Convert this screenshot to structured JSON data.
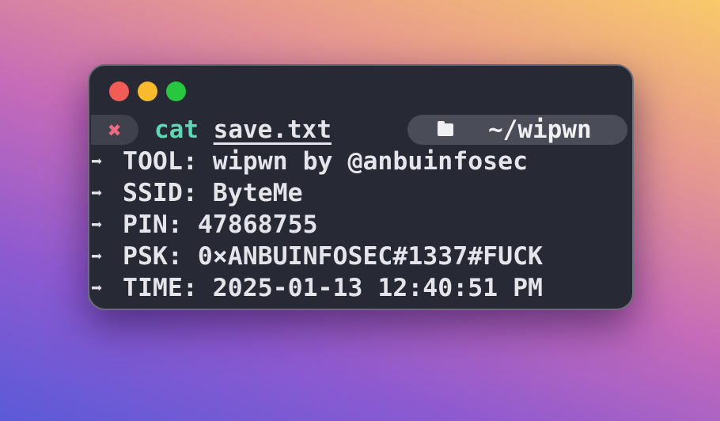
{
  "window": {
    "controls": [
      {
        "name": "close",
        "color": "#f25c57"
      },
      {
        "name": "minimize",
        "color": "#f9bb2c"
      },
      {
        "name": "maximize",
        "color": "#27c840"
      }
    ]
  },
  "prompt": {
    "status_icon": "✖",
    "command": "cat",
    "argument": "save.txt",
    "directory": "~/wipwn"
  },
  "output": [
    {
      "key": "TOOL:",
      "value": "wipwn by @anbuinfosec"
    },
    {
      "key": "SSID:",
      "value": "ByteMe"
    },
    {
      "key": "PIN:",
      "value": "47868755"
    },
    {
      "key": "PSK:",
      "value": "0×ANBUINFOSEC#1337#FUCK"
    },
    {
      "key": "TIME:",
      "value": "2025-01-13 12:40:51 PM"
    }
  ],
  "arrow_glyph": "➡"
}
